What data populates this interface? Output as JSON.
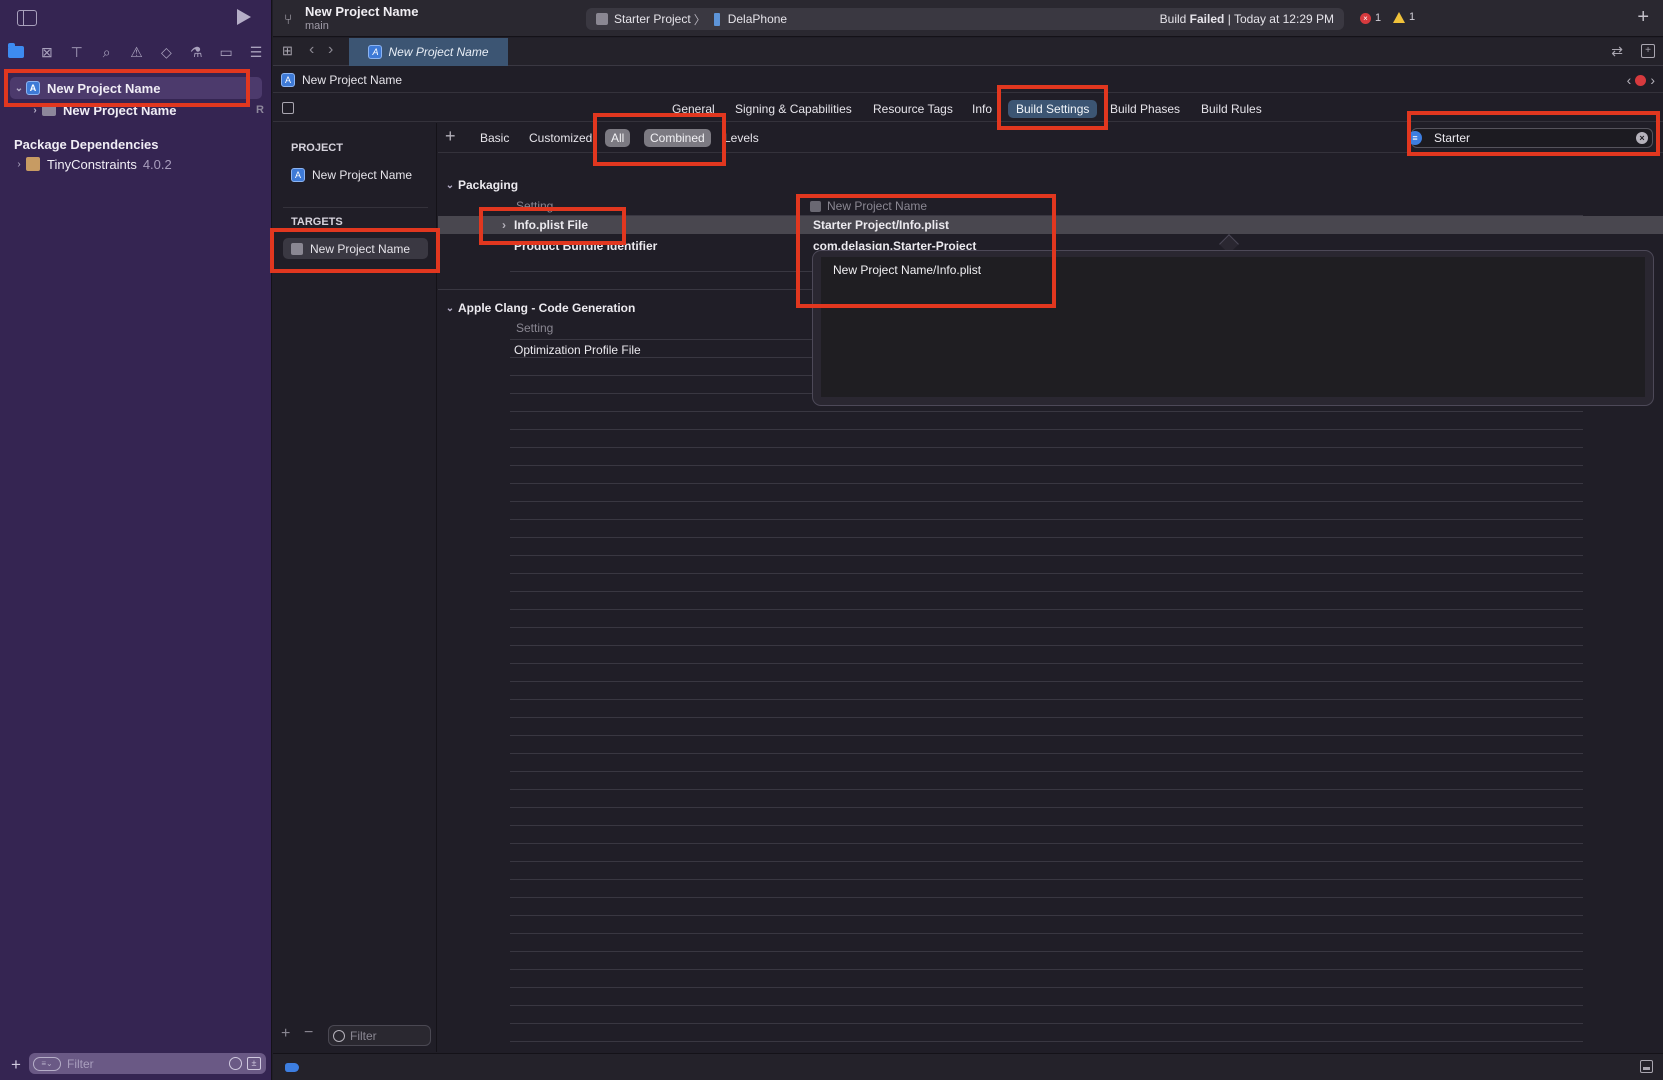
{
  "sidebar": {
    "nav_icons": [
      "folder-icon",
      "source-control-icon",
      "hierarchy-icon",
      "search-icon",
      "warning-icon",
      "test-icon",
      "debug-icon",
      "breakpoint-icon",
      "report-icon"
    ],
    "tree": [
      {
        "label": "New Project Name",
        "expanded": true,
        "selected": true
      },
      {
        "label": "New Project Name",
        "badge": "R"
      }
    ],
    "package_dependencies_header": "Package Dependencies",
    "packages": [
      {
        "name": "TinyConstraints",
        "version": "4.0.2"
      }
    ],
    "filter_placeholder": "Filter"
  },
  "toolbar": {
    "project_name": "New Project Name",
    "branch": "main",
    "scheme": "Starter Project",
    "scheme_separator": "〉",
    "device": "DelaPhone",
    "status_prefix": "Build",
    "status_result": "Failed",
    "status_time": "| Today at 12:29 PM",
    "error_count": "1",
    "warning_count": "1"
  },
  "tabbar": {
    "active_tab": "New Project Name"
  },
  "jumpbar": {
    "path": "New Project Name"
  },
  "settings_tabs": [
    {
      "label": "General",
      "active": false
    },
    {
      "label": "Signing & Capabilities",
      "active": false
    },
    {
      "label": "Resource Tags",
      "active": false
    },
    {
      "label": "Info",
      "active": false
    },
    {
      "label": "Build Settings",
      "active": true
    },
    {
      "label": "Build Phases",
      "active": false
    },
    {
      "label": "Build Rules",
      "active": false
    }
  ],
  "targets_panel": {
    "project_header": "PROJECT",
    "project_item": "New Project Name",
    "targets_header": "TARGETS",
    "target_item": "New Project Name",
    "filter_placeholder": "Filter"
  },
  "filter_bar": {
    "basic": "Basic",
    "customized": "Customized",
    "all": "All",
    "combined": "Combined",
    "levels": "Levels",
    "search_value": "Starter"
  },
  "groups": [
    {
      "title": "Packaging",
      "column_setting": "Setting",
      "column_target": "New Project Name",
      "rows": [
        {
          "setting": "Info.plist File",
          "value": "Starter Project/Info.plist",
          "selected": true
        },
        {
          "setting": "Product Bundle Identifier",
          "value": "com.delasign.Starter-Project"
        }
      ]
    },
    {
      "title": "Apple Clang - Code Generation",
      "column_setting": "Setting",
      "rows": [
        {
          "setting": "Optimization Profile File",
          "value": ""
        }
      ]
    }
  ],
  "editor_popover": {
    "value": "New Project Name/Info.plist"
  },
  "colors": {
    "sidebar_bg": "#352552",
    "accent_blue": "#3c5573",
    "annotation_red": "#e1371f",
    "error_red": "#d63a3e",
    "warning_yellow": "#f0c23a"
  }
}
